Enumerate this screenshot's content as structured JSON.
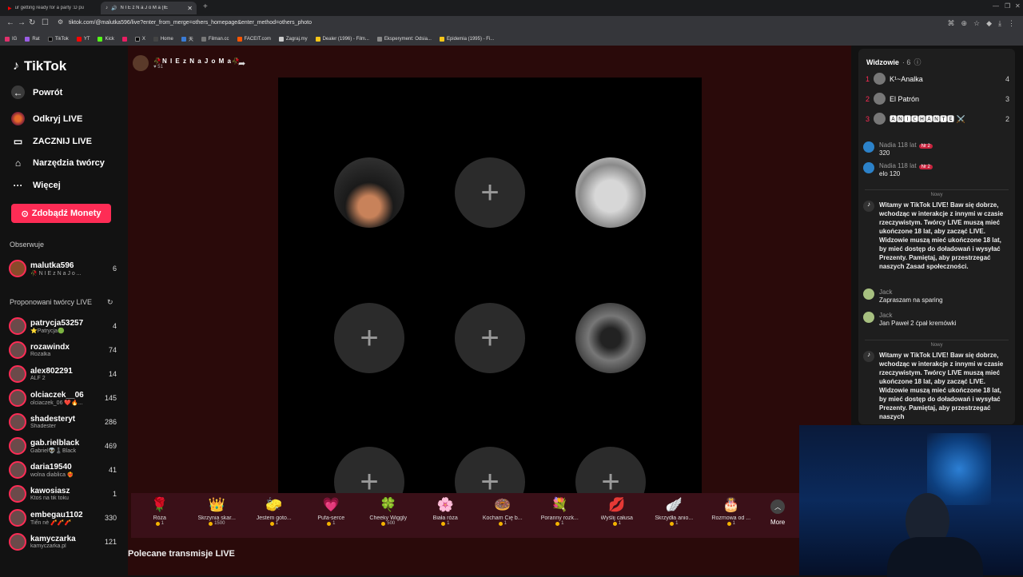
{
  "browser": {
    "tabs": [
      {
        "title": "ur getting ready for a party :D pu",
        "active": false
      },
      {
        "title": "N I E z N a J o M a  (IE",
        "active": true
      }
    ],
    "url": "tiktok.com/@malutka596/live?enter_from_merge=others_homepage&enter_method=others_photo",
    "bookmarks": [
      "IG",
      "Rat",
      "TikTok",
      "YT",
      "Kick",
      "",
      "X",
      "Home",
      "天",
      "Filman.cc",
      "FACEIT.com",
      "Zagraj.my",
      "Dealer (1996) - Film...",
      "Eksperyment: Odsia...",
      "Epidemia (1995) - Fi..."
    ]
  },
  "sidebar": {
    "logo": "TikTok",
    "back": "Powrót",
    "nav": [
      "Odkryj LIVE",
      "ZACZNIJ LIVE",
      "Narzędzia twórcy",
      "Więcej"
    ],
    "coins_button": "Zdobądź Monety",
    "following_title": "Obserwuje",
    "following": [
      {
        "name": "malutka596",
        "sub": "🥀 N I E z N a J o ...",
        "count": "6"
      }
    ],
    "suggested_title": "Proponowani twórcy LIVE",
    "creators": [
      {
        "name": "patrycja53257",
        "sub": "⭐Patrycja🟢",
        "count": "4"
      },
      {
        "name": "rozawindx",
        "sub": "Rozalka",
        "count": "74"
      },
      {
        "name": "alex802291",
        "sub": "ALF 2",
        "count": "14"
      },
      {
        "name": "olciaczek__06",
        "sub": "olciaczek_06 ❤️🔥...",
        "count": "145"
      },
      {
        "name": "shadesteryt",
        "sub": "Shadester",
        "count": "286"
      },
      {
        "name": "gab.rielblack",
        "sub": "Gabriel👽♟️Black",
        "count": "469"
      },
      {
        "name": "daria19540",
        "sub": "wolna diablica ❤️‍🔥",
        "count": "41"
      },
      {
        "name": "kawosiasz",
        "sub": "Ktoś na tik toku",
        "count": "1"
      },
      {
        "name": "embegau1102",
        "sub": "Tiến nè 🧨🧨🧨",
        "count": "330"
      },
      {
        "name": "kamyczarka",
        "sub": "kamyczarka.pl",
        "count": "121"
      }
    ]
  },
  "stage": {
    "host_name": "🥀N I E z N a J o M a🥀",
    "host_likes": "51",
    "gifts": [
      {
        "icon": "🌹",
        "name": "Róża",
        "price": "1"
      },
      {
        "icon": "👑",
        "name": "Skrzynia skar...",
        "price": "1500"
      },
      {
        "icon": "🧽",
        "name": "Jestem goto...",
        "price": "1"
      },
      {
        "icon": "💗",
        "name": "Pufa-serce",
        "price": "1"
      },
      {
        "icon": "🍀",
        "name": "Cheeky Wiggly",
        "price": "500"
      },
      {
        "icon": "🌸",
        "name": "Biała róża",
        "price": "1"
      },
      {
        "icon": "🍩",
        "name": "Kocham Cię b...",
        "price": "1"
      },
      {
        "icon": "💐",
        "name": "Poranny rozk...",
        "price": "1"
      },
      {
        "icon": "💋",
        "name": "Wyślij całusa",
        "price": "1"
      },
      {
        "icon": "🪽",
        "name": "Skrzydła anio...",
        "price": "1"
      },
      {
        "icon": "🎂",
        "name": "Rozmowa od ...",
        "price": "1"
      }
    ],
    "more_label": "More",
    "recommended_title": "Polecane transmisje LIVE"
  },
  "panel": {
    "title": "Widzowie",
    "count": "· 6",
    "ranking": [
      {
        "rank": "1",
        "name": "K¹~Analka",
        "value": "4"
      },
      {
        "rank": "2",
        "name": "El Patrón",
        "value": "3"
      },
      {
        "rank": "3",
        "name": "🅰🅽🅸🅲🅷🅰🅽🆃🅴 ⚔️",
        "value": "2"
      }
    ],
    "chat": [
      {
        "name": "Nadia 118 lat",
        "badge": "Nr 2",
        "text": "320"
      },
      {
        "name": "Nadia 118 lat",
        "badge": "Nr 2",
        "text": "elo 120"
      },
      {
        "divider": "Nowy"
      },
      {
        "name": "",
        "text": "Witamy w TikTok LIVE! Baw się dobrze, wchodząc w interakcje z innymi w czasie rzeczywistym. Twórcy LIVE muszą mieć ukończone 18 lat, aby zacząć LIVE. Widzowie muszą mieć ukończone 18 lat, by mieć dostęp do doładowań i wysyłać Prezenty. Pamiętaj, aby przestrzegać naszych Zasad społeczności."
      },
      {
        "name": "Jack",
        "text": "Zapraszam na sparing"
      },
      {
        "name": "Jack",
        "text": "Jan Paweł 2 ćpał kremówki"
      },
      {
        "divider": "Nowy"
      },
      {
        "name": "",
        "text": "Witamy w TikTok LIVE! Baw się dobrze, wchodząc w interakcje z innymi w czasie rzeczywistym. Twórcy LIVE muszą mieć ukończone 18 lat, aby zacząć LIVE. Widzowie muszą mieć ukończone 18 lat, by mieć dostęp do doładowań i wysyłać Prezenty. Pamiętaj, aby przestrzegać naszych"
      }
    ]
  }
}
